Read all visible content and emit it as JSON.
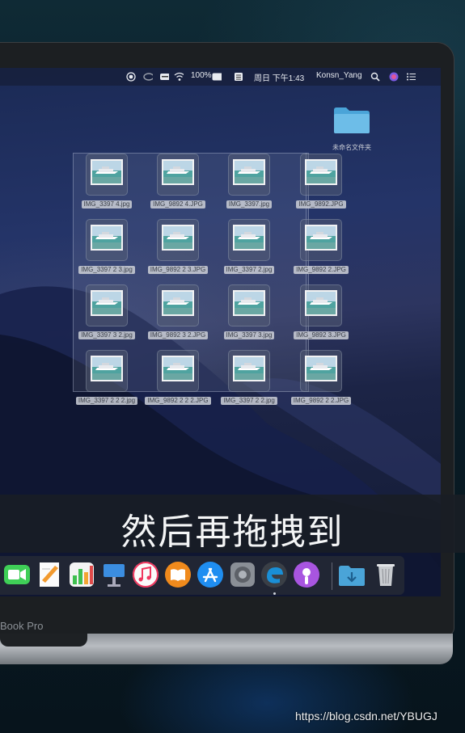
{
  "menubar": {
    "battery": "100%",
    "clock": "周日 下午1:43",
    "user": "Konsn_Yang"
  },
  "desktop": {
    "folder_label": "未命名文件夹",
    "files": [
      {
        "name": "IMG_3397 4.jpg"
      },
      {
        "name": "IMG_9892 4.JPG"
      },
      {
        "name": "IMG_3397.jpg"
      },
      {
        "name": "IMG_9892.JPG"
      },
      {
        "name": "IMG_3397 2 3.jpg"
      },
      {
        "name": "IMG_9892 2 3.JPG"
      },
      {
        "name": "IMG_3397 2.jpg"
      },
      {
        "name": "IMG_9892 2.JPG"
      },
      {
        "name": "IMG_3397 3 2.jpg"
      },
      {
        "name": "IMG_9892 3 2.JPG"
      },
      {
        "name": "IMG_3397 3.jpg"
      },
      {
        "name": "IMG_9892 3.JPG"
      },
      {
        "name": "IMG_3397 2 2 2.jpg"
      },
      {
        "name": "IMG_9892 2 2 2.JPG"
      },
      {
        "name": "IMG_3397 2 2.jpg"
      },
      {
        "name": "IMG_9892 2 2.JPG"
      }
    ]
  },
  "subtitle": "然后再拖拽到",
  "laptop_model": "Book Pro",
  "watermark": "https://blog.csdn.net/YBUGJ",
  "dock": {
    "items": [
      "facetime-icon",
      "pages-icon",
      "numbers-icon",
      "keynote-icon",
      "music-icon",
      "books-icon",
      "app-store-icon",
      "system-preferences-icon",
      "edge-icon",
      "podcasts-icon",
      "downloads-folder-icon",
      "trash-icon"
    ]
  },
  "colors": {
    "accent": "#5aa9dc",
    "selection": "#b4bed2"
  }
}
